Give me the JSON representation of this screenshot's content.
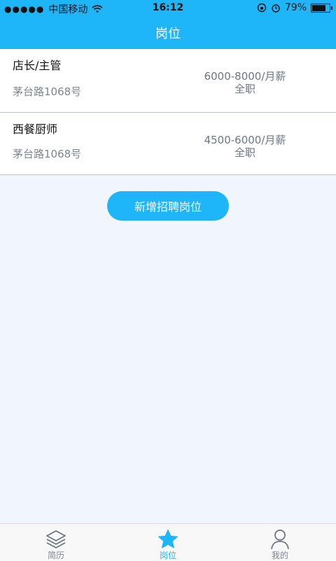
{
  "status_bar": {
    "carrier": "中国移动",
    "time": "16:12",
    "battery": "79%",
    "battery_level": 0.79
  },
  "nav": {
    "title": "岗位"
  },
  "jobs": [
    {
      "title": "店长/主管",
      "address": "茅台路1068号",
      "salary": "6000-8000/月薪",
      "type": "全职"
    },
    {
      "title": "西餐厨师",
      "address": "茅台路1068号",
      "salary": "4500-6000/月薪",
      "type": "全职"
    }
  ],
  "add_button": {
    "label": "新增招聘岗位"
  },
  "tabs": [
    {
      "label": "简历",
      "icon": "layers-icon",
      "active": false
    },
    {
      "label": "岗位",
      "icon": "star-icon",
      "active": true
    },
    {
      "label": "我的",
      "icon": "user-icon",
      "active": false
    }
  ],
  "colors": {
    "primary": "#1fb5f9",
    "inactive": "#7a8793",
    "background": "#f0f6fc"
  }
}
